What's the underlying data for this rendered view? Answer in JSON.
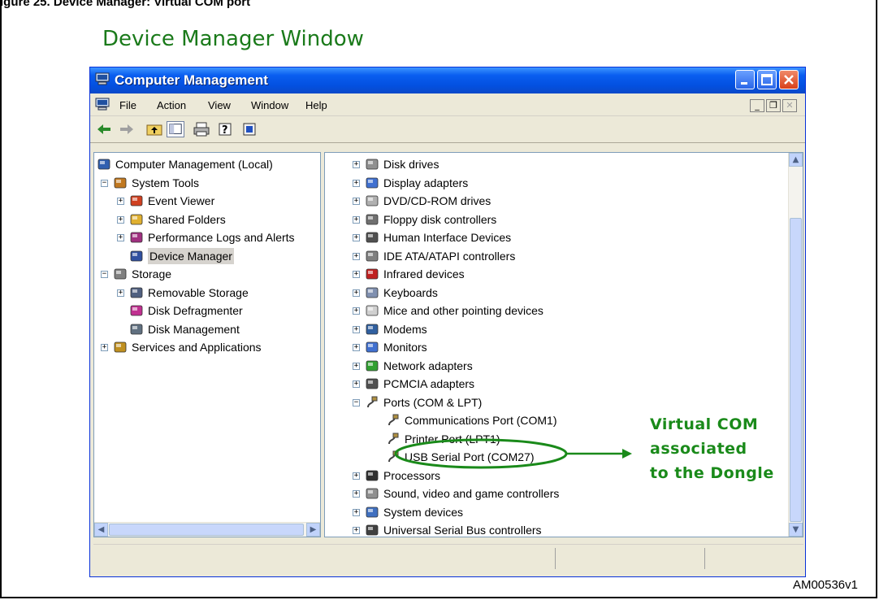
{
  "figure": {
    "caption_fragment": "igure 25. Device Manager: Virtual COM port",
    "title": "Device Manager Window",
    "figure_id": "AM00536v1"
  },
  "window": {
    "title": "Computer Management",
    "menu": [
      "File",
      "Action",
      "View",
      "Window",
      "Help"
    ],
    "toolbar_icons": [
      "back-arrow-icon",
      "forward-arrow-icon",
      "up-folder-icon",
      "show-hide-tree-icon",
      "print-icon",
      "help-icon",
      "properties-icon"
    ]
  },
  "left_tree": [
    {
      "label": "Computer Management (Local)",
      "level": 0,
      "expander": "",
      "icon": "computer-icon"
    },
    {
      "label": "System Tools",
      "level": 1,
      "expander": "−",
      "icon": "system-tools-icon"
    },
    {
      "label": "Event Viewer",
      "level": 2,
      "expander": "+",
      "icon": "event-viewer-icon"
    },
    {
      "label": "Shared Folders",
      "level": 2,
      "expander": "+",
      "icon": "shared-folders-icon"
    },
    {
      "label": "Performance Logs and Alerts",
      "level": 2,
      "expander": "+",
      "icon": "performance-icon"
    },
    {
      "label": "Device Manager",
      "level": 2,
      "expander": "",
      "icon": "device-manager-icon",
      "selected": true
    },
    {
      "label": "Storage",
      "level": 1,
      "expander": "−",
      "icon": "storage-icon"
    },
    {
      "label": "Removable Storage",
      "level": 2,
      "expander": "+",
      "icon": "removable-storage-icon"
    },
    {
      "label": "Disk Defragmenter",
      "level": 2,
      "expander": "",
      "icon": "defragmenter-icon"
    },
    {
      "label": "Disk Management",
      "level": 2,
      "expander": "",
      "icon": "disk-management-icon"
    },
    {
      "label": "Services and Applications",
      "level": 1,
      "expander": "+",
      "icon": "services-icon"
    }
  ],
  "right_tree": [
    {
      "label": "Disk drives",
      "level": 0,
      "expander": "+",
      "icon": "disk-drive-icon"
    },
    {
      "label": "Display adapters",
      "level": 0,
      "expander": "+",
      "icon": "display-adapter-icon"
    },
    {
      "label": "DVD/CD-ROM drives",
      "level": 0,
      "expander": "+",
      "icon": "dvd-icon"
    },
    {
      "label": "Floppy disk controllers",
      "level": 0,
      "expander": "+",
      "icon": "floppy-icon"
    },
    {
      "label": "Human Interface Devices",
      "level": 0,
      "expander": "+",
      "icon": "hid-icon"
    },
    {
      "label": "IDE ATA/ATAPI controllers",
      "level": 0,
      "expander": "+",
      "icon": "ide-icon"
    },
    {
      "label": "Infrared devices",
      "level": 0,
      "expander": "+",
      "icon": "infrared-icon"
    },
    {
      "label": "Keyboards",
      "level": 0,
      "expander": "+",
      "icon": "keyboard-icon"
    },
    {
      "label": "Mice and other pointing devices",
      "level": 0,
      "expander": "+",
      "icon": "mouse-icon"
    },
    {
      "label": "Modems",
      "level": 0,
      "expander": "+",
      "icon": "modem-icon"
    },
    {
      "label": "Monitors",
      "level": 0,
      "expander": "+",
      "icon": "monitor-icon"
    },
    {
      "label": "Network adapters",
      "level": 0,
      "expander": "+",
      "icon": "network-adapter-icon"
    },
    {
      "label": "PCMCIA adapters",
      "level": 0,
      "expander": "+",
      "icon": "pcmcia-icon"
    },
    {
      "label": "Ports (COM & LPT)",
      "level": 0,
      "expander": "−",
      "icon": "port-icon"
    },
    {
      "label": "Communications Port (COM1)",
      "level": 1,
      "expander": "",
      "icon": "port-icon"
    },
    {
      "label": "Printer Port (LPT1)",
      "level": 1,
      "expander": "",
      "icon": "port-icon"
    },
    {
      "label": "USB Serial Port (COM27)",
      "level": 1,
      "expander": "",
      "icon": "port-icon"
    },
    {
      "label": "Processors",
      "level": 0,
      "expander": "+",
      "icon": "processor-icon"
    },
    {
      "label": "Sound, video and game controllers",
      "level": 0,
      "expander": "+",
      "icon": "sound-icon"
    },
    {
      "label": "System devices",
      "level": 0,
      "expander": "+",
      "icon": "system-device-icon"
    },
    {
      "label": "Universal Serial Bus controllers",
      "level": 0,
      "expander": "+",
      "icon": "usb-icon"
    }
  ],
  "annotation": {
    "lines": [
      "Virtual COM",
      "associated",
      "to the Dongle"
    ],
    "color": "#1a8a1a"
  },
  "colors": {
    "title_green": "#1a7a1a",
    "titlebar_blue": "#0a5ef0",
    "close_red": "#d8401a"
  }
}
